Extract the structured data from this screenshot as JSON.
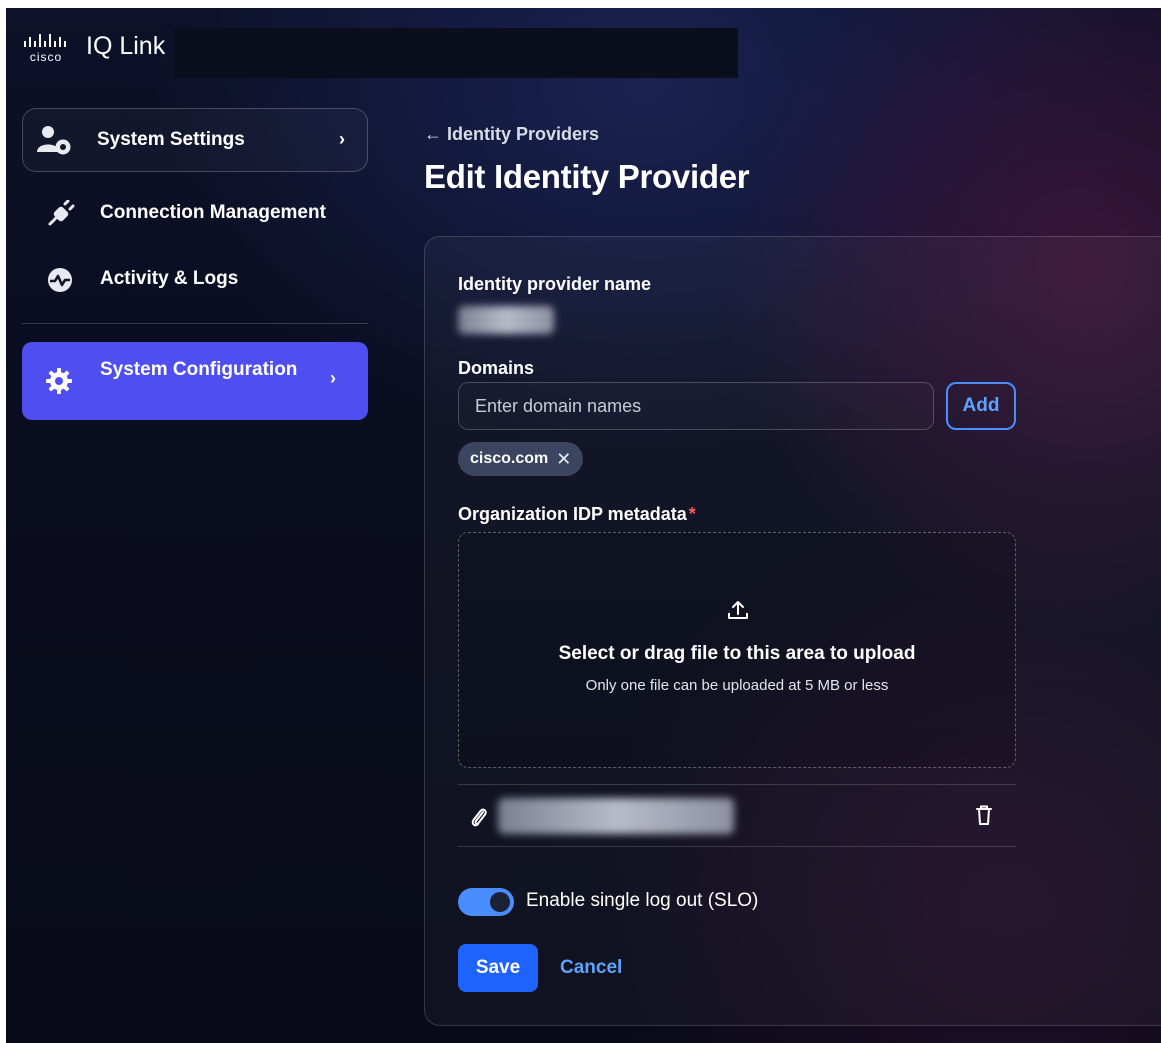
{
  "header": {
    "brand_logo_text": "cisco",
    "app_title": "IQ Link"
  },
  "sidebar": {
    "items": [
      {
        "label": "System Settings",
        "icon": "user-gear-icon"
      },
      {
        "label": "Connection Management",
        "icon": "plug-icon"
      },
      {
        "label": "Activity & Logs",
        "icon": "activity-icon"
      },
      {
        "label": "System Configuration",
        "icon": "gear-icon",
        "active": true
      }
    ],
    "active_color": "#4f4ef0"
  },
  "page": {
    "back_label": "← Identity Providers",
    "title": "Edit Identity Provider"
  },
  "form": {
    "idp_name_label": "Identity provider name",
    "domains_label": "Domains",
    "domains_placeholder": "Enter domain names",
    "add_label": "Add",
    "domain_chips": [
      "cisco.com"
    ],
    "metadata_label": "Organization IDP metadata",
    "required_marker": "*",
    "upload_title": "Select or drag file to this area to upload",
    "upload_hint": "Only one file can be uploaded at 5 MB or less",
    "slo_label": "Enable single log out (SLO)",
    "slo_enabled": true,
    "save_label": "Save",
    "cancel_label": "Cancel",
    "accent_color": "#4a8dff"
  }
}
